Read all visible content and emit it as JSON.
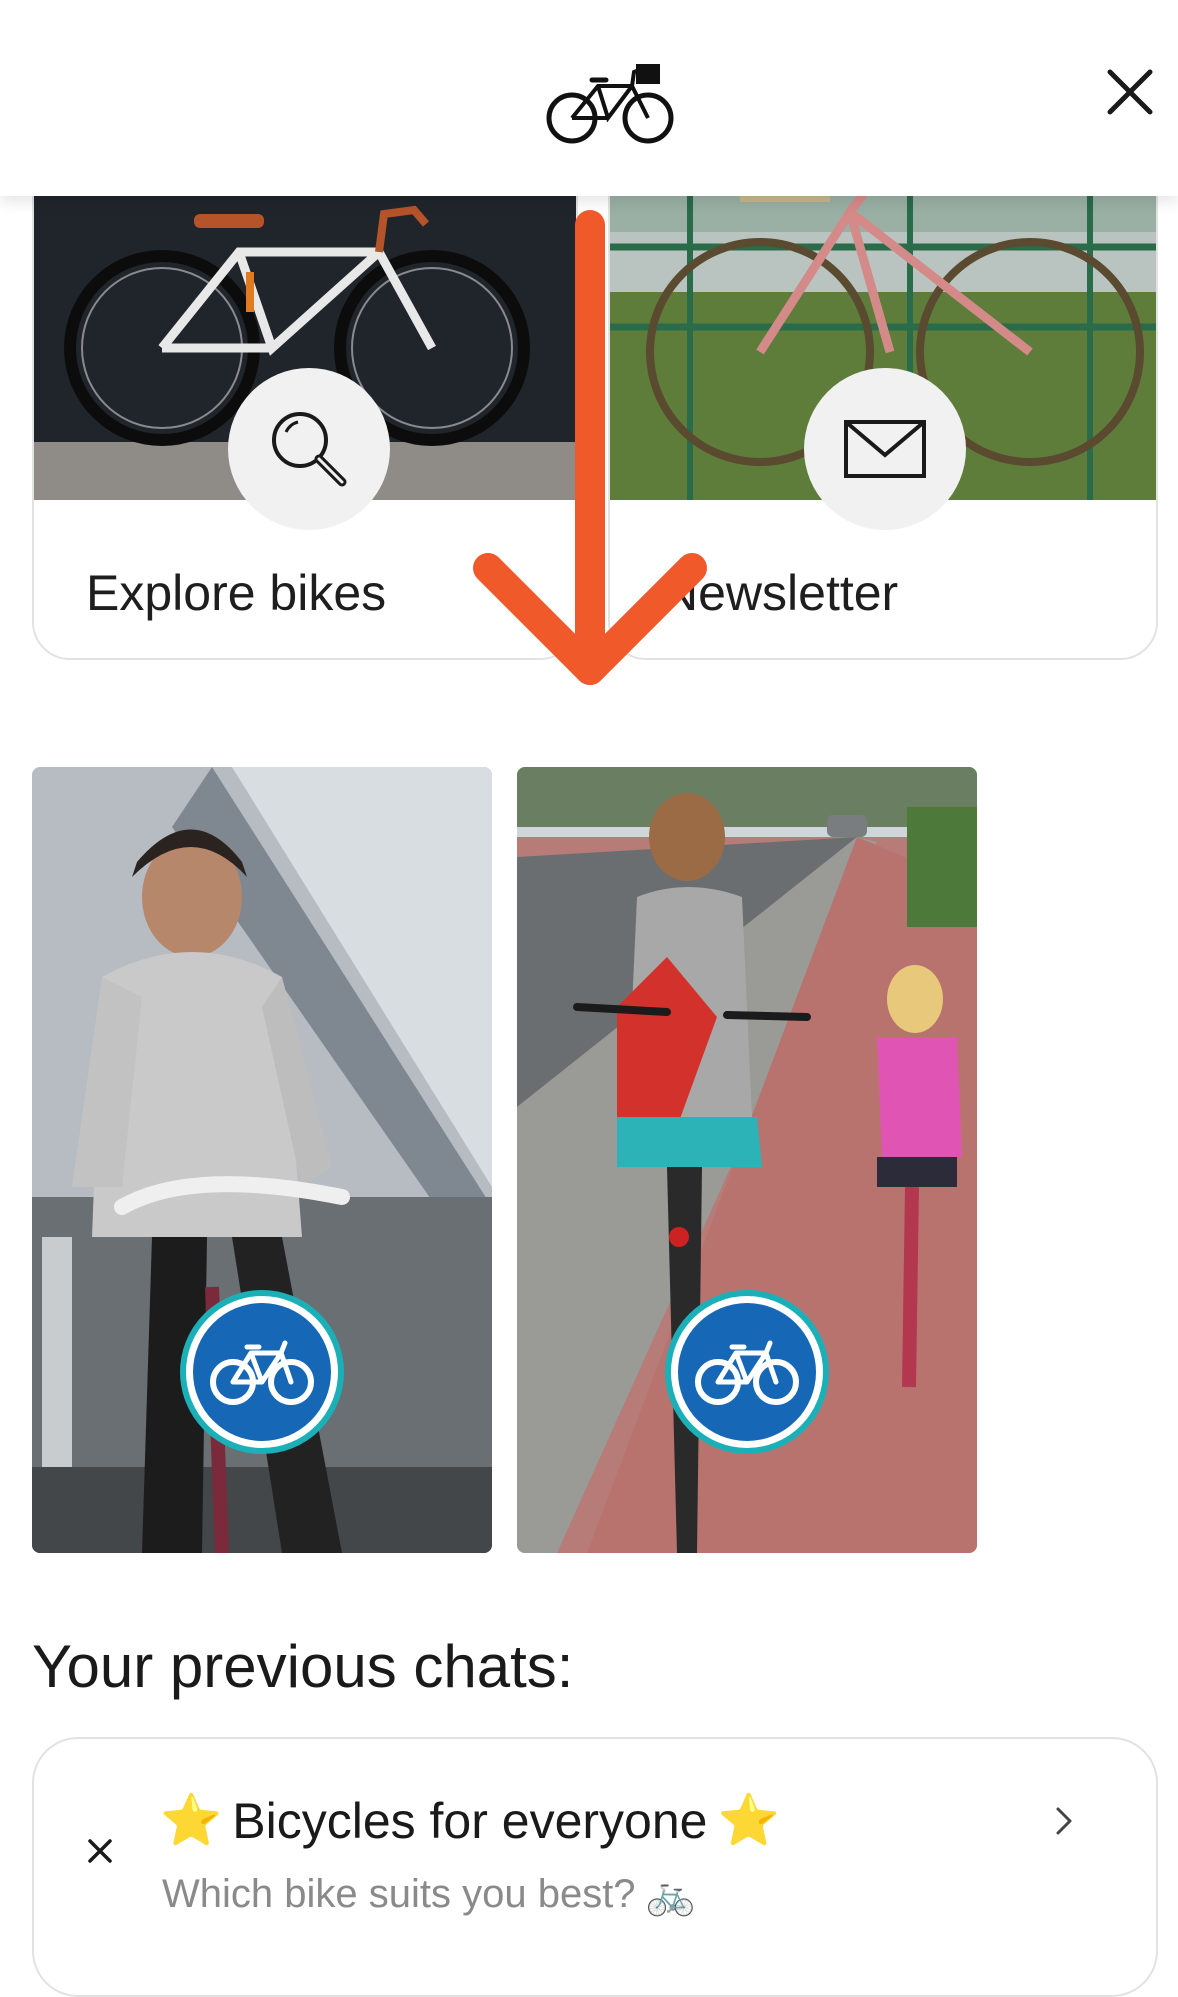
{
  "header": {
    "logo_icon": "bicycle-basket-icon",
    "close_icon": "close-icon"
  },
  "cards": [
    {
      "label": "Explore bikes",
      "icon": "magnifier-icon"
    },
    {
      "label": "Newsletter",
      "icon": "envelope-icon"
    }
  ],
  "tiles": [
    {
      "icon": "bike-path-sign-icon"
    },
    {
      "icon": "bike-path-sign-icon"
    }
  ],
  "chats": {
    "title": "Your previous chats:",
    "items": [
      {
        "star_left": "⭐",
        "title": "Bicycles for everyone",
        "star_right": "⭐",
        "subtitle": "Which bike suits you best?",
        "subtitle_emoji": "🚲"
      }
    ]
  },
  "overlay": {
    "arrow_color": "#f05a2a",
    "direction": "down"
  },
  "colors": {
    "accent_sign": "#1667b6",
    "sign_ring": "#1bb0b8"
  }
}
